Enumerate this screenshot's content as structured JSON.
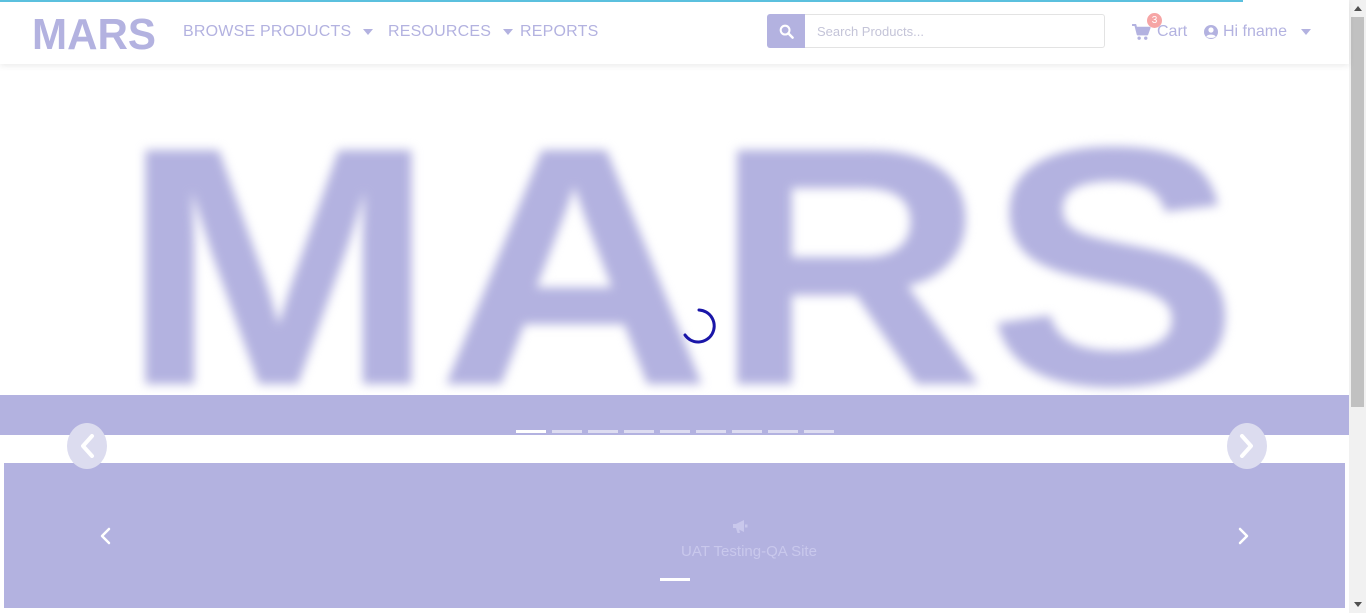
{
  "loading": {
    "progress_percent": 91
  },
  "header": {
    "logo_text": "MARS",
    "nav": [
      {
        "label": "BROWSE PRODUCTS",
        "has_dropdown": true
      },
      {
        "label": "RESOURCES",
        "has_dropdown": true
      },
      {
        "label": "REPORTS",
        "has_dropdown": false
      }
    ],
    "search": {
      "placeholder": "Search Products..."
    },
    "cart": {
      "label": "Cart",
      "count": "3"
    },
    "user": {
      "greeting": "Hi fname"
    }
  },
  "hero": {
    "logo_text": "MARS",
    "slide_count": 9,
    "active_slide": 1
  },
  "announcement": {
    "icon": "bullhorn-icon",
    "text": "UAT Testing-QA Site"
  },
  "colors": {
    "brand": "#b3b2e0",
    "progress": "#5bc0de",
    "badge": "#f6a5a5",
    "spinner": "#1a16a8"
  }
}
